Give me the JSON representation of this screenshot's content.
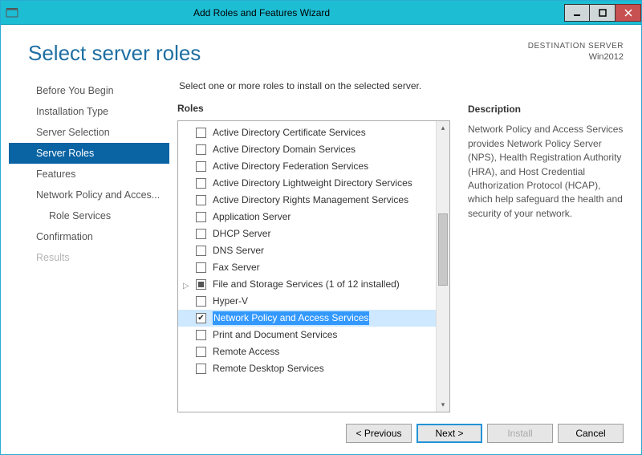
{
  "window": {
    "title": "Add Roles and Features Wizard"
  },
  "header": {
    "page_title": "Select server roles",
    "destination_label": "DESTINATION SERVER",
    "destination_value": "Win2012"
  },
  "nav": {
    "items": [
      {
        "label": "Before You Begin",
        "id": "before-you-begin"
      },
      {
        "label": "Installation Type",
        "id": "installation-type"
      },
      {
        "label": "Server Selection",
        "id": "server-selection"
      },
      {
        "label": "Server Roles",
        "id": "server-roles",
        "active": true
      },
      {
        "label": "Features",
        "id": "features"
      },
      {
        "label": "Network Policy and Acces...",
        "id": "npas"
      },
      {
        "label": "Role Services",
        "id": "role-services",
        "sub": true
      },
      {
        "label": "Confirmation",
        "id": "confirmation"
      },
      {
        "label": "Results",
        "id": "results",
        "disabled": true
      }
    ]
  },
  "main": {
    "instruction": "Select one or more roles to install on the selected server.",
    "roles_heading": "Roles",
    "desc_heading": "Description",
    "description": "Network Policy and Access Services provides Network Policy Server (NPS), Health Registration Authority (HRA), and Host Credential Authorization Protocol (HCAP), which help safeguard the health and security of your network.",
    "roles": [
      {
        "label": "Active Directory Certificate Services"
      },
      {
        "label": "Active Directory Domain Services"
      },
      {
        "label": "Active Directory Federation Services"
      },
      {
        "label": "Active Directory Lightweight Directory Services"
      },
      {
        "label": "Active Directory Rights Management Services"
      },
      {
        "label": "Application Server"
      },
      {
        "label": "DHCP Server"
      },
      {
        "label": "DNS Server"
      },
      {
        "label": "Fax Server"
      },
      {
        "label": "File and Storage Services (1 of 12 installed)",
        "indeterminate": true,
        "expandable": true
      },
      {
        "label": "Hyper-V"
      },
      {
        "label": "Network Policy and Access Services",
        "checked": true,
        "selected": true
      },
      {
        "label": "Print and Document Services"
      },
      {
        "label": "Remote Access"
      },
      {
        "label": "Remote Desktop Services"
      }
    ]
  },
  "footer": {
    "previous": "< Previous",
    "next": "Next >",
    "install": "Install",
    "cancel": "Cancel"
  }
}
